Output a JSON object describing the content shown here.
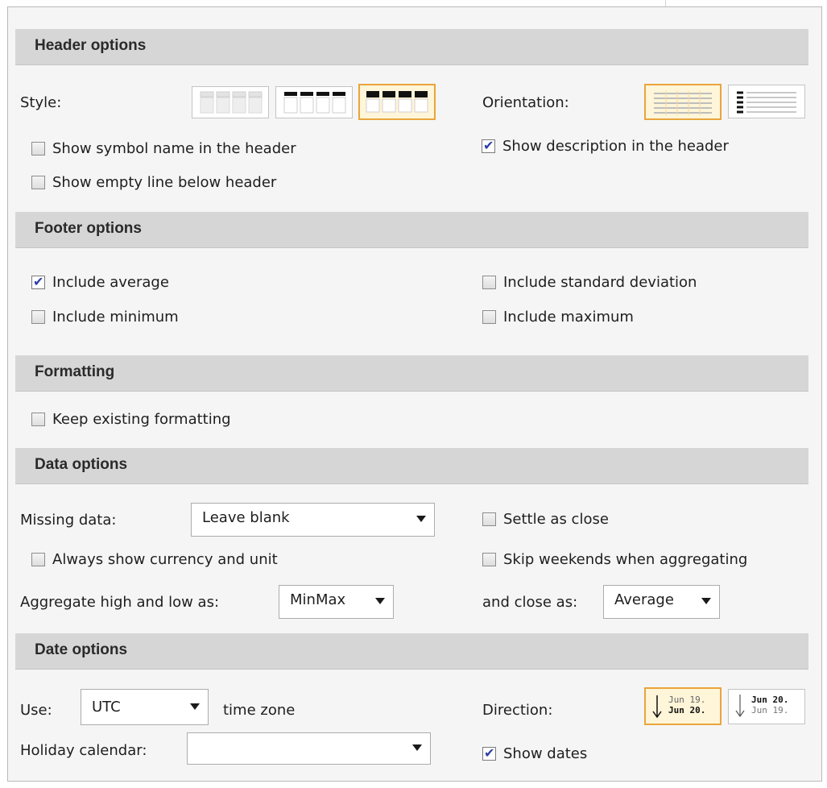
{
  "sections": {
    "header": {
      "title": "Header options",
      "style_label": "Style:",
      "orientation_label": "Orientation:",
      "show_symbol": "Show symbol name in the header",
      "show_empty_line": "Show empty line below header",
      "show_description": "Show description in the header",
      "show_symbol_checked": false,
      "show_empty_line_checked": false,
      "show_description_checked": true,
      "style_selected": 3,
      "orientation_selected": 1
    },
    "footer": {
      "title": "Footer options",
      "include_average": "Include average",
      "include_minimum": "Include minimum",
      "include_std": "Include standard deviation",
      "include_maximum": "Include maximum",
      "include_average_checked": true
    },
    "formatting": {
      "title": "Formatting",
      "keep_existing": "Keep existing formatting"
    },
    "data": {
      "title": "Data options",
      "missing_label": "Missing data:",
      "missing_value": "Leave blank",
      "settle_close": "Settle as close",
      "always_show_currency": "Always show currency and unit",
      "skip_weekends": "Skip weekends when aggregating",
      "aggregate_label": "Aggregate high and low as:",
      "aggregate_value": "MinMax",
      "close_as_label": "and close as:",
      "close_as_value": "Average"
    },
    "date": {
      "title": "Date options",
      "use_label": "Use:",
      "timezone_value": "UTC",
      "timezone_suffix": "time zone",
      "holiday_label": "Holiday calendar:",
      "holiday_value": "",
      "direction_label": "Direction:",
      "dir1_line1": "Jun 19.",
      "dir1_line2": "Jun 20.",
      "dir2_line1": "Jun 20.",
      "dir2_line2": "Jun 19.",
      "direction_selected": 1,
      "show_dates": "Show dates",
      "show_dates_checked": true
    }
  },
  "colors": {
    "selected_border": "#e9a53c",
    "check_mark": "#2b3fa8",
    "section_header_bg": "#d6d6d6"
  },
  "icons": {
    "check": "check-mark-icon",
    "dropdown": "chevron-down-icon",
    "arrow_down": "arrow-down-icon"
  }
}
